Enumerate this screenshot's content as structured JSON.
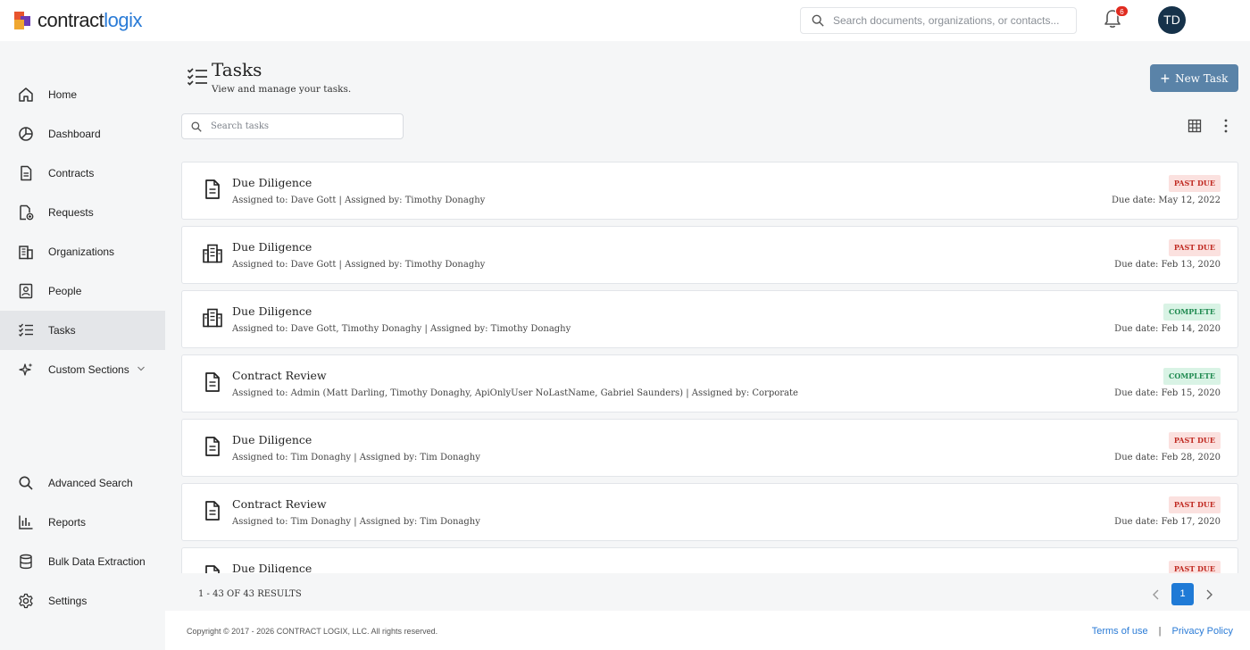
{
  "brand": {
    "logo_part1": "contract",
    "logo_part2": "logix"
  },
  "header": {
    "search_placeholder": "Search documents, organizations, or contacts...",
    "notifications_count": "6",
    "avatar_initials": "TD"
  },
  "sidebar": {
    "items": [
      {
        "label": "Home",
        "icon": "home-icon"
      },
      {
        "label": "Dashboard",
        "icon": "dashboard-icon"
      },
      {
        "label": "Contracts",
        "icon": "contract-icon"
      },
      {
        "label": "Requests",
        "icon": "request-icon"
      },
      {
        "label": "Organizations",
        "icon": "organization-icon"
      },
      {
        "label": "People",
        "icon": "people-icon"
      },
      {
        "label": "Tasks",
        "icon": "tasks-icon",
        "active": true
      },
      {
        "label": "Custom Sections",
        "icon": "sparkle-icon"
      }
    ],
    "bottom_items": [
      {
        "label": "Advanced Search",
        "icon": "search-icon"
      },
      {
        "label": "Reports",
        "icon": "reports-icon"
      },
      {
        "label": "Bulk Data Extraction",
        "icon": "database-icon"
      },
      {
        "label": "Settings",
        "icon": "gear-icon"
      }
    ]
  },
  "page": {
    "title": "Tasks",
    "subtitle": "View and manage your tasks.",
    "new_button_label": "New Task",
    "search_placeholder": "Search tasks"
  },
  "tasks": [
    {
      "title": "Due Diligence",
      "meta": "Assigned to: Dave Gott | Assigned by: Timothy Donaghy",
      "status": "PAST DUE",
      "due": "Due date: May 12, 2022",
      "icon": "document-icon"
    },
    {
      "title": "Due Diligence",
      "meta": "Assigned to: Dave Gott | Assigned by: Timothy Donaghy",
      "status": "PAST DUE",
      "due": "Due date: Feb 13, 2020",
      "icon": "organization-icon"
    },
    {
      "title": "Due Diligence",
      "meta": "Assigned to: Dave Gott, Timothy Donaghy | Assigned by: Timothy Donaghy",
      "status": "COMPLETE",
      "due": "Due date: Feb 14, 2020",
      "icon": "organization-icon"
    },
    {
      "title": "Contract Review",
      "meta": "Assigned to: Admin (Matt Darling, Timothy Donaghy, ApiOnlyUser NoLastName, Gabriel Saunders) | Assigned by: Corporate",
      "status": "COMPLETE",
      "due": "Due date: Feb 15, 2020",
      "icon": "document-icon"
    },
    {
      "title": "Due Diligence",
      "meta": "Assigned to: Tim Donaghy | Assigned by: Tim Donaghy",
      "status": "PAST DUE",
      "due": "Due date: Feb 28, 2020",
      "icon": "document-icon"
    },
    {
      "title": "Contract Review",
      "meta": "Assigned to: Tim Donaghy | Assigned by: Tim Donaghy",
      "status": "PAST DUE",
      "due": "Due date: Feb 17, 2020",
      "icon": "document-icon"
    },
    {
      "title": "Due Diligence",
      "meta": "",
      "status": "PAST DUE",
      "due": "",
      "icon": "document-icon"
    }
  ],
  "pagination": {
    "summary": "1 - 43 OF 43 RESULTS",
    "current_page": "1"
  },
  "footer": {
    "copyright": "Copyright © 2017 - 2026 CONTRACT LOGIX, LLC. All rights reserved.",
    "terms": "Terms of use",
    "separator": "|",
    "privacy": "Privacy Policy"
  },
  "colors": {
    "accent": "#1f7ad6",
    "new_button": "#5a83a8",
    "past_due": "#c02a22",
    "complete": "#1f8a50"
  }
}
